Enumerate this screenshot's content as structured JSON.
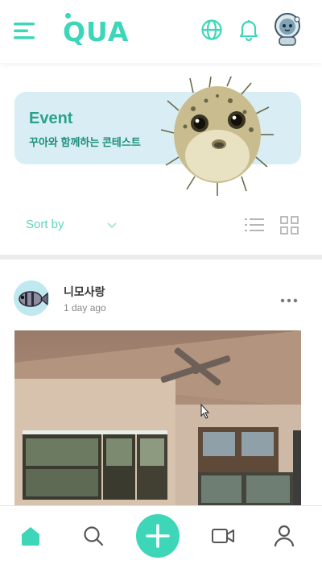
{
  "header": {
    "logo": "QUA",
    "menu_icon": "hamburger-menu-icon",
    "globe_icon": "globe-icon",
    "bell_icon": "bell-icon",
    "avatar_icon": "astronaut-cat-avatar"
  },
  "banner": {
    "title": "Event",
    "subtitle": "꾸아와 함께하는 콘테스트",
    "image_icon": "pufferfish-illustration",
    "background_color": "#d8eef4"
  },
  "sort": {
    "label": "Sort by",
    "caret_icon": "chevron-down-icon",
    "list_view_icon": "list-view-icon",
    "grid_view_icon": "grid-view-icon"
  },
  "post": {
    "author": "니모사랑",
    "time": "1 day ago",
    "avatar_icon": "fish-avatar",
    "more_icon": "more-dots-icon",
    "image_icon": "aquarium-room-photo"
  },
  "bottom_nav": {
    "home_icon": "home-icon",
    "search_icon": "search-icon",
    "add_icon": "plus-icon",
    "video_icon": "video-camera-icon",
    "profile_icon": "person-icon"
  },
  "colors": {
    "accent": "#3dd6b8",
    "banner_text": "#2aa28b"
  }
}
